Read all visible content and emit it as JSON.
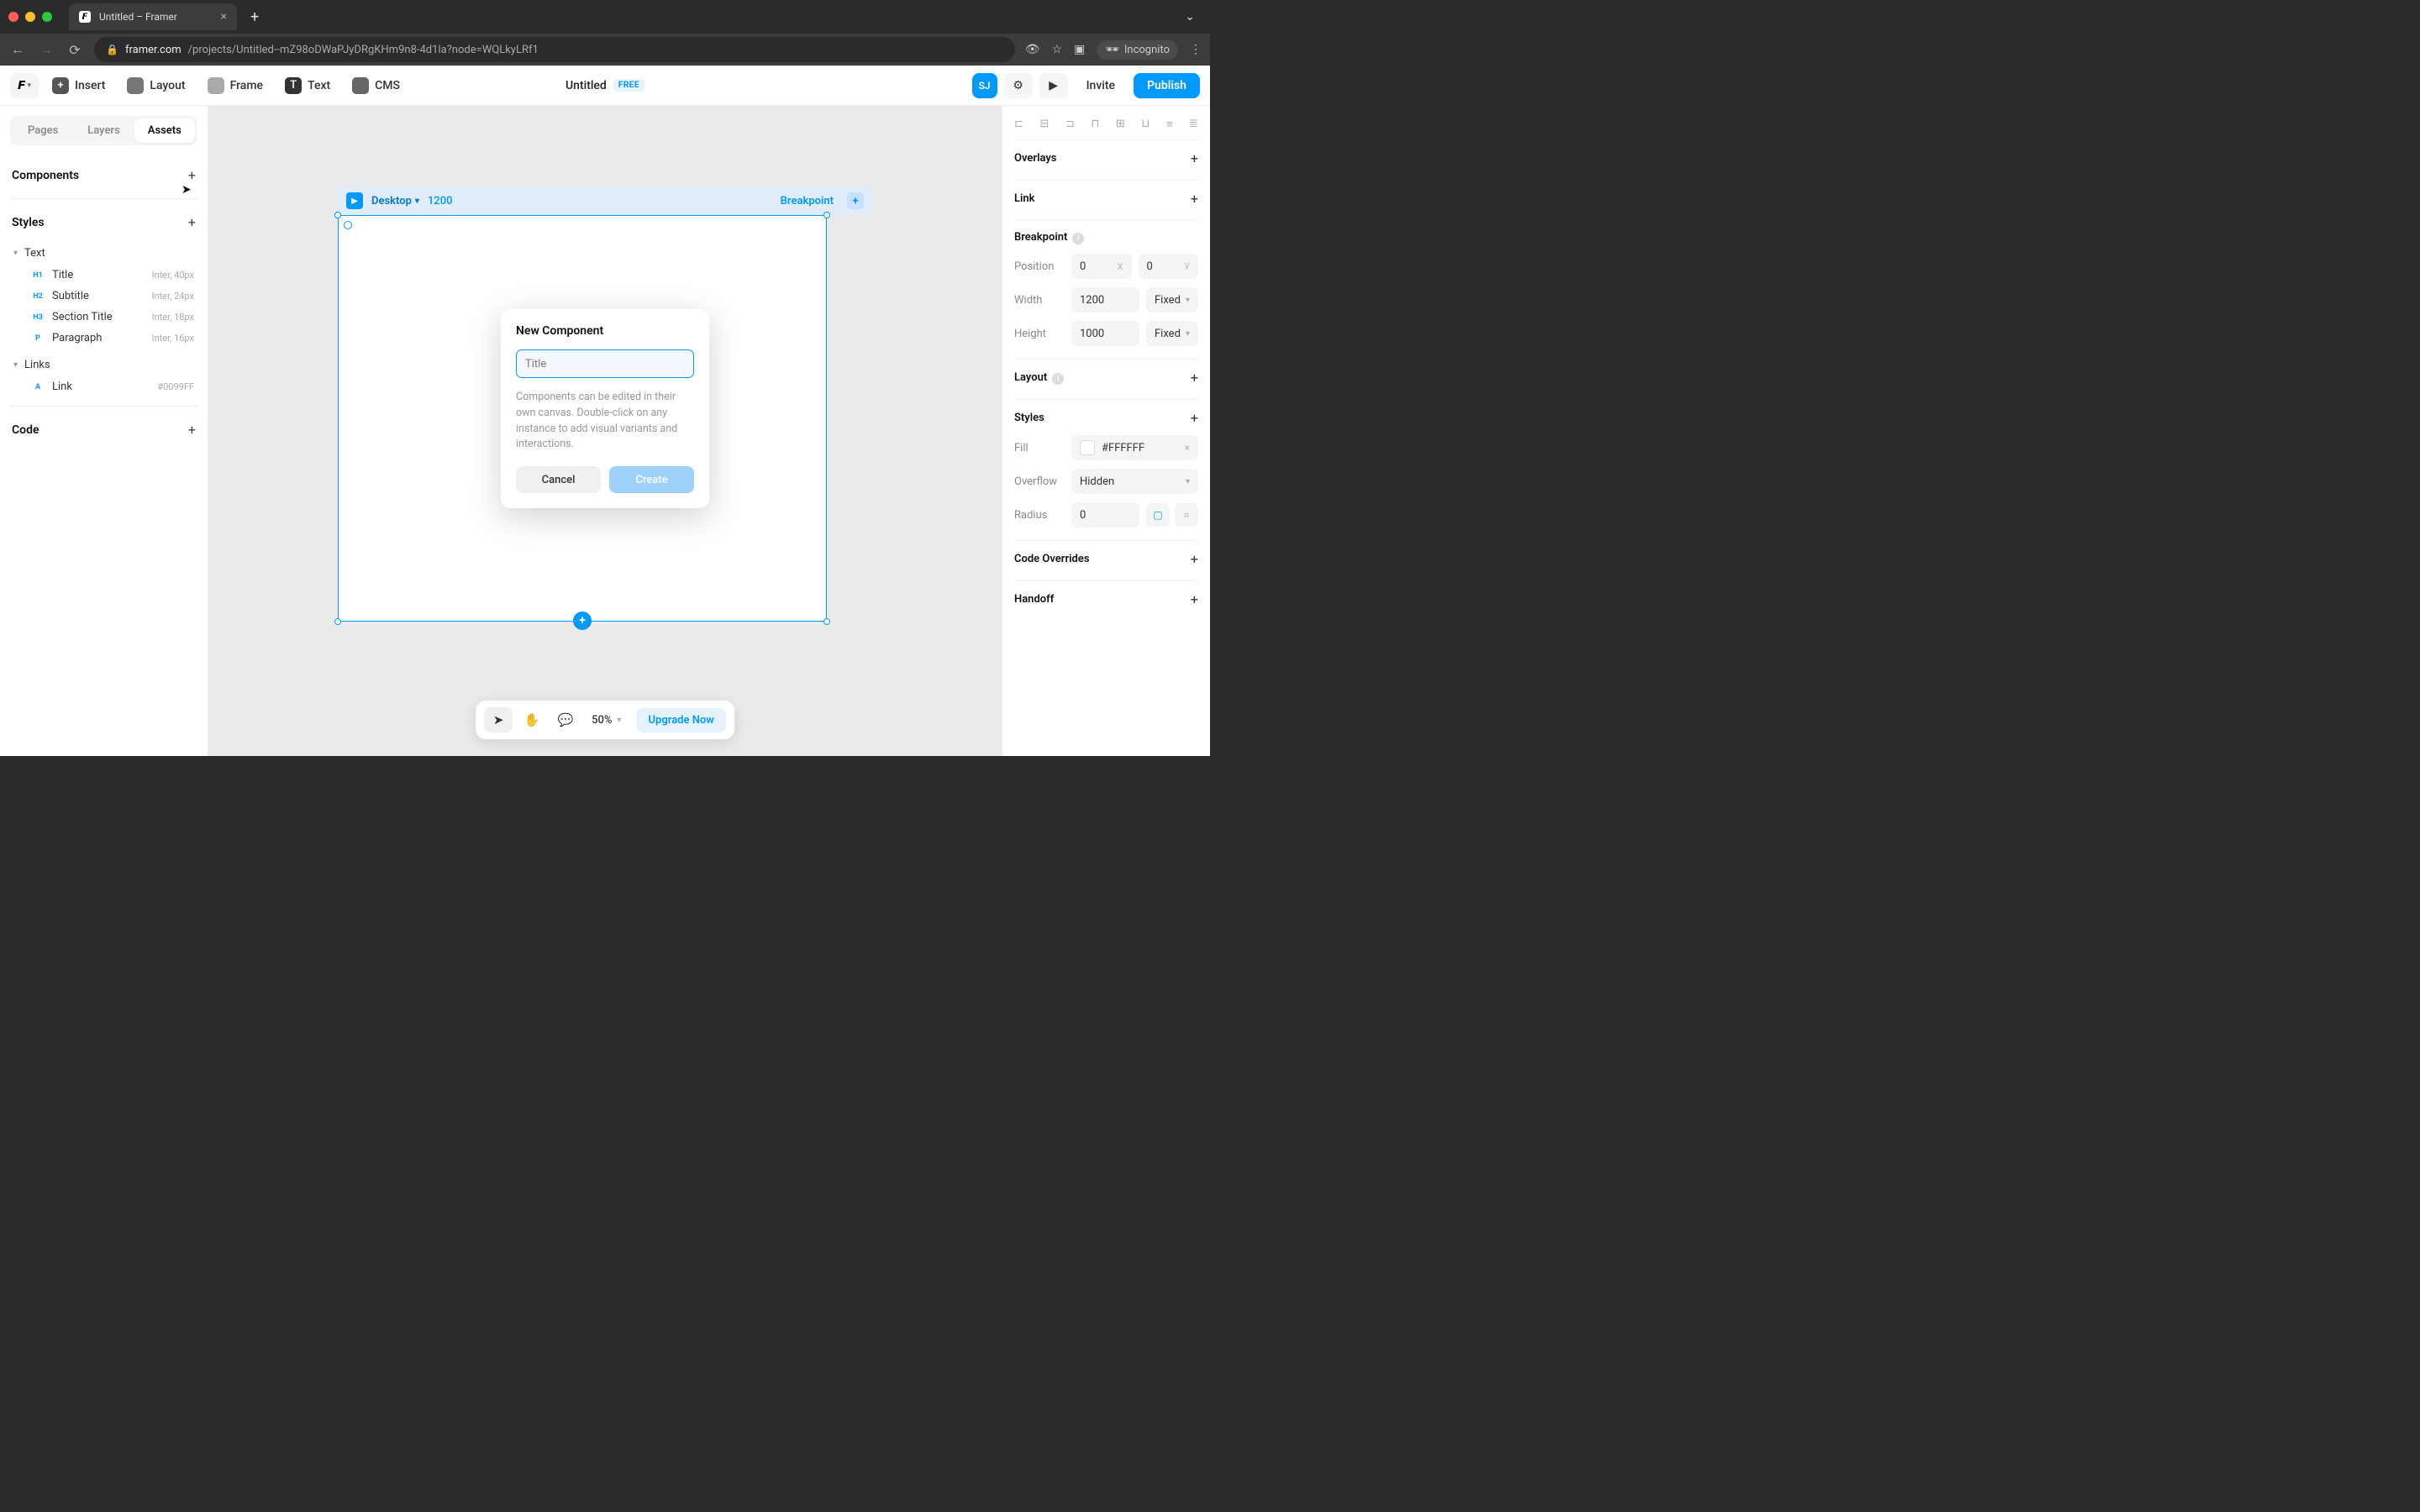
{
  "browser": {
    "tab_title": "Untitled – Framer",
    "url_domain": "framer.com",
    "url_path": "/projects/Untitled--mZ98oDWaPJyDRgKHm9n8-4d1la?node=WQLkyLRf1",
    "incognito_label": "Incognito"
  },
  "toolbar": {
    "insert": "Insert",
    "layout": "Layout",
    "frame": "Frame",
    "text": "Text",
    "cms": "CMS",
    "doc_title": "Untitled",
    "free_badge": "FREE",
    "avatar": "SJ",
    "invite": "Invite",
    "publish": "Publish"
  },
  "left": {
    "tabs": [
      "Pages",
      "Layers",
      "Assets"
    ],
    "active_tab": 2,
    "sections": {
      "components": "Components",
      "styles": "Styles",
      "code": "Code"
    },
    "text_group": "Text",
    "links_group": "Links",
    "styles_list": [
      {
        "tag": "H1",
        "name": "Title",
        "meta": "Inter, 40px"
      },
      {
        "tag": "H2",
        "name": "Subtitle",
        "meta": "Inter, 24px"
      },
      {
        "tag": "H3",
        "name": "Section Title",
        "meta": "Inter, 18px"
      },
      {
        "tag": "P",
        "name": "Paragraph",
        "meta": "Inter, 16px"
      }
    ],
    "link_style": {
      "tag": "A",
      "name": "Link",
      "meta": "#0099FF"
    }
  },
  "canvas": {
    "frame_name": "Desktop",
    "frame_width": "1200",
    "breakpoint_label": "Breakpoint"
  },
  "right": {
    "overlays": "Overlays",
    "link": "Link",
    "breakpoint": "Breakpoint",
    "position_label": "Position",
    "position_x": "0",
    "position_y": "0",
    "width_label": "Width",
    "width_val": "1200",
    "width_mode": "Fixed",
    "height_label": "Height",
    "height_val": "1000",
    "height_mode": "Fixed",
    "layout": "Layout",
    "styles": "Styles",
    "fill_label": "Fill",
    "fill_val": "#FFFFFF",
    "overflow_label": "Overflow",
    "overflow_val": "Hidden",
    "radius_label": "Radius",
    "radius_val": "0",
    "code_overrides": "Code Overrides",
    "handoff": "Handoff"
  },
  "floatbar": {
    "zoom": "50%",
    "upgrade": "Upgrade Now"
  },
  "modal": {
    "title": "New Component",
    "placeholder": "Title",
    "help": "Components can be edited in their own canvas. Double-click on any instance to add visual variants and interactions.",
    "cancel": "Cancel",
    "create": "Create"
  }
}
